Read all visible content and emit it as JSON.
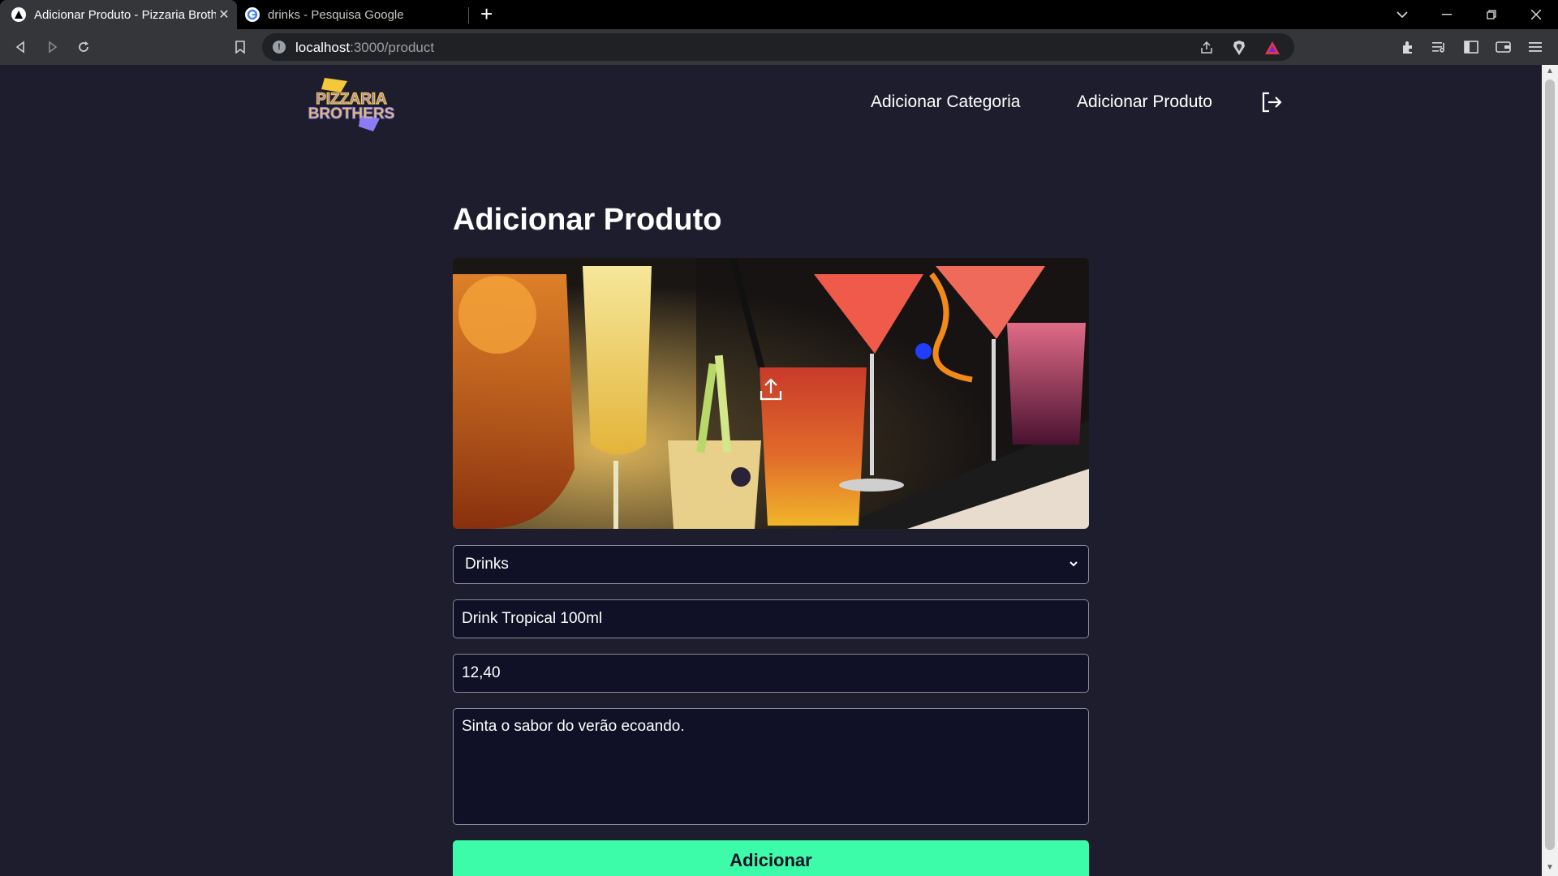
{
  "browser": {
    "tabs": [
      {
        "title": "Adicionar Produto - Pizzaria Broth",
        "active": true
      },
      {
        "title": "drinks - Pesquisa Google",
        "active": false
      }
    ],
    "url_host": "localhost",
    "url_path": ":3000/product"
  },
  "header": {
    "logo_line1": "PIZZARIA",
    "logo_line2": "BROTHERS",
    "nav": {
      "add_category": "Adicionar Categoria",
      "add_product": "Adicionar Produto"
    }
  },
  "form": {
    "title": "Adicionar Produto",
    "category_selected": "Drinks",
    "name_value": "Drink Tropical 100ml",
    "price_value": "12,40",
    "description_value": "Sinta o sabor do verão ecoando.",
    "submit_label": "Adicionar"
  },
  "colors": {
    "background": "#1d1d2e",
    "field_background": "#101026",
    "accent_green": "#3dfca9",
    "logo_yellow": "#f5c83b",
    "logo_purple": "#8b7cf6"
  }
}
